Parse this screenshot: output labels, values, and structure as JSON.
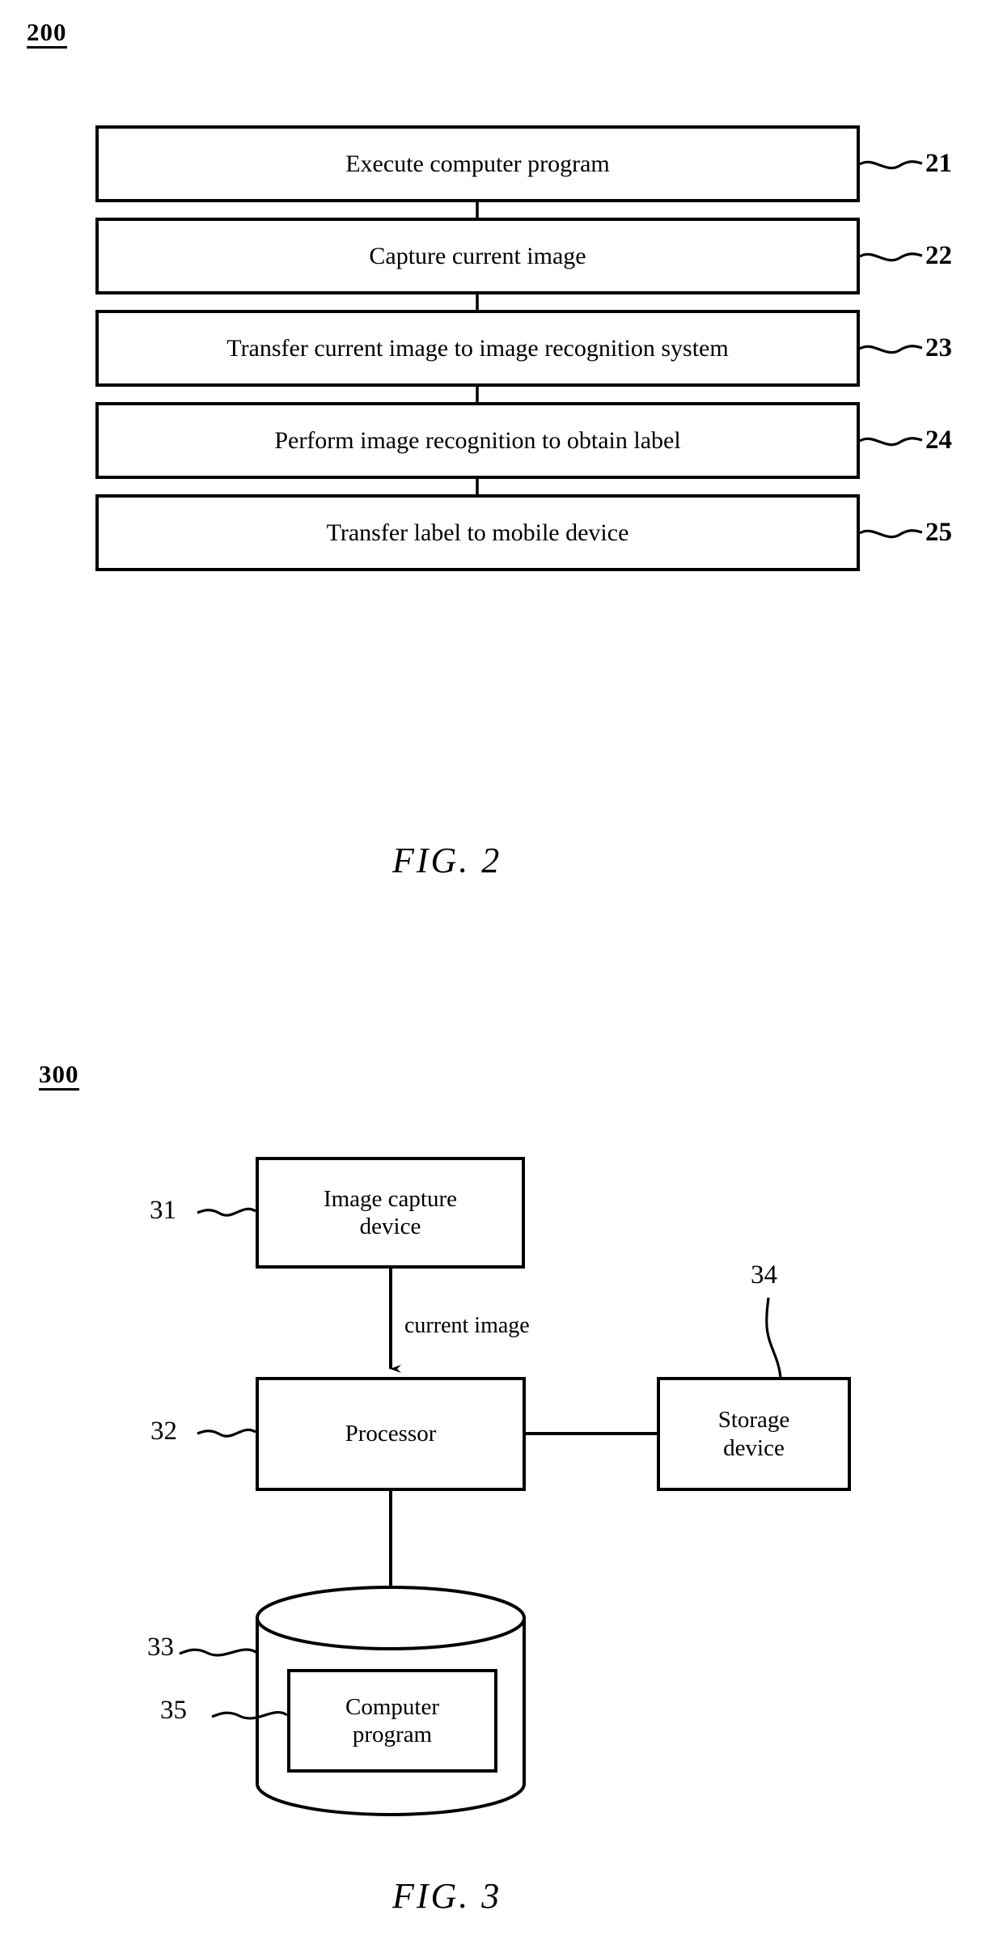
{
  "document": {
    "type": "patent-drawing-sheet",
    "figures": [
      {
        "id": "fig2",
        "ref_numeral": "200",
        "caption": "FIG. 2",
        "kind": "flowchart",
        "steps": [
          {
            "ref": "21",
            "label": "Execute computer program"
          },
          {
            "ref": "22",
            "label": "Capture current image"
          },
          {
            "ref": "23",
            "label": "Transfer current image to image recognition system"
          },
          {
            "ref": "24",
            "label": "Perform image recognition to obtain label"
          },
          {
            "ref": "25",
            "label": "Transfer label to mobile device"
          }
        ]
      },
      {
        "id": "fig3",
        "ref_numeral": "300",
        "caption": "FIG. 3",
        "kind": "block-diagram",
        "blocks": [
          {
            "ref": "31",
            "label": "Image capture\ndevice",
            "line1": "Image capture",
            "line2": "device",
            "shape": "rectangle"
          },
          {
            "ref": "32",
            "label": "Processor",
            "line1": "Processor",
            "line2": "",
            "shape": "rectangle"
          },
          {
            "ref": "34",
            "label": "Storage\ndevice",
            "line1": "Storage",
            "line2": "device",
            "shape": "rectangle"
          },
          {
            "ref": "33",
            "label": "",
            "line1": "",
            "line2": "",
            "shape": "cylinder"
          },
          {
            "ref": "35",
            "label": "Computer\nprogram",
            "line1": "Computer",
            "line2": "program",
            "shape": "rectangle-inner"
          }
        ],
        "edge_labels": [
          {
            "text": "current image",
            "from": "31",
            "to": "32"
          }
        ]
      }
    ],
    "colors": {
      "ink": "#000000",
      "paper": "#ffffff"
    }
  }
}
